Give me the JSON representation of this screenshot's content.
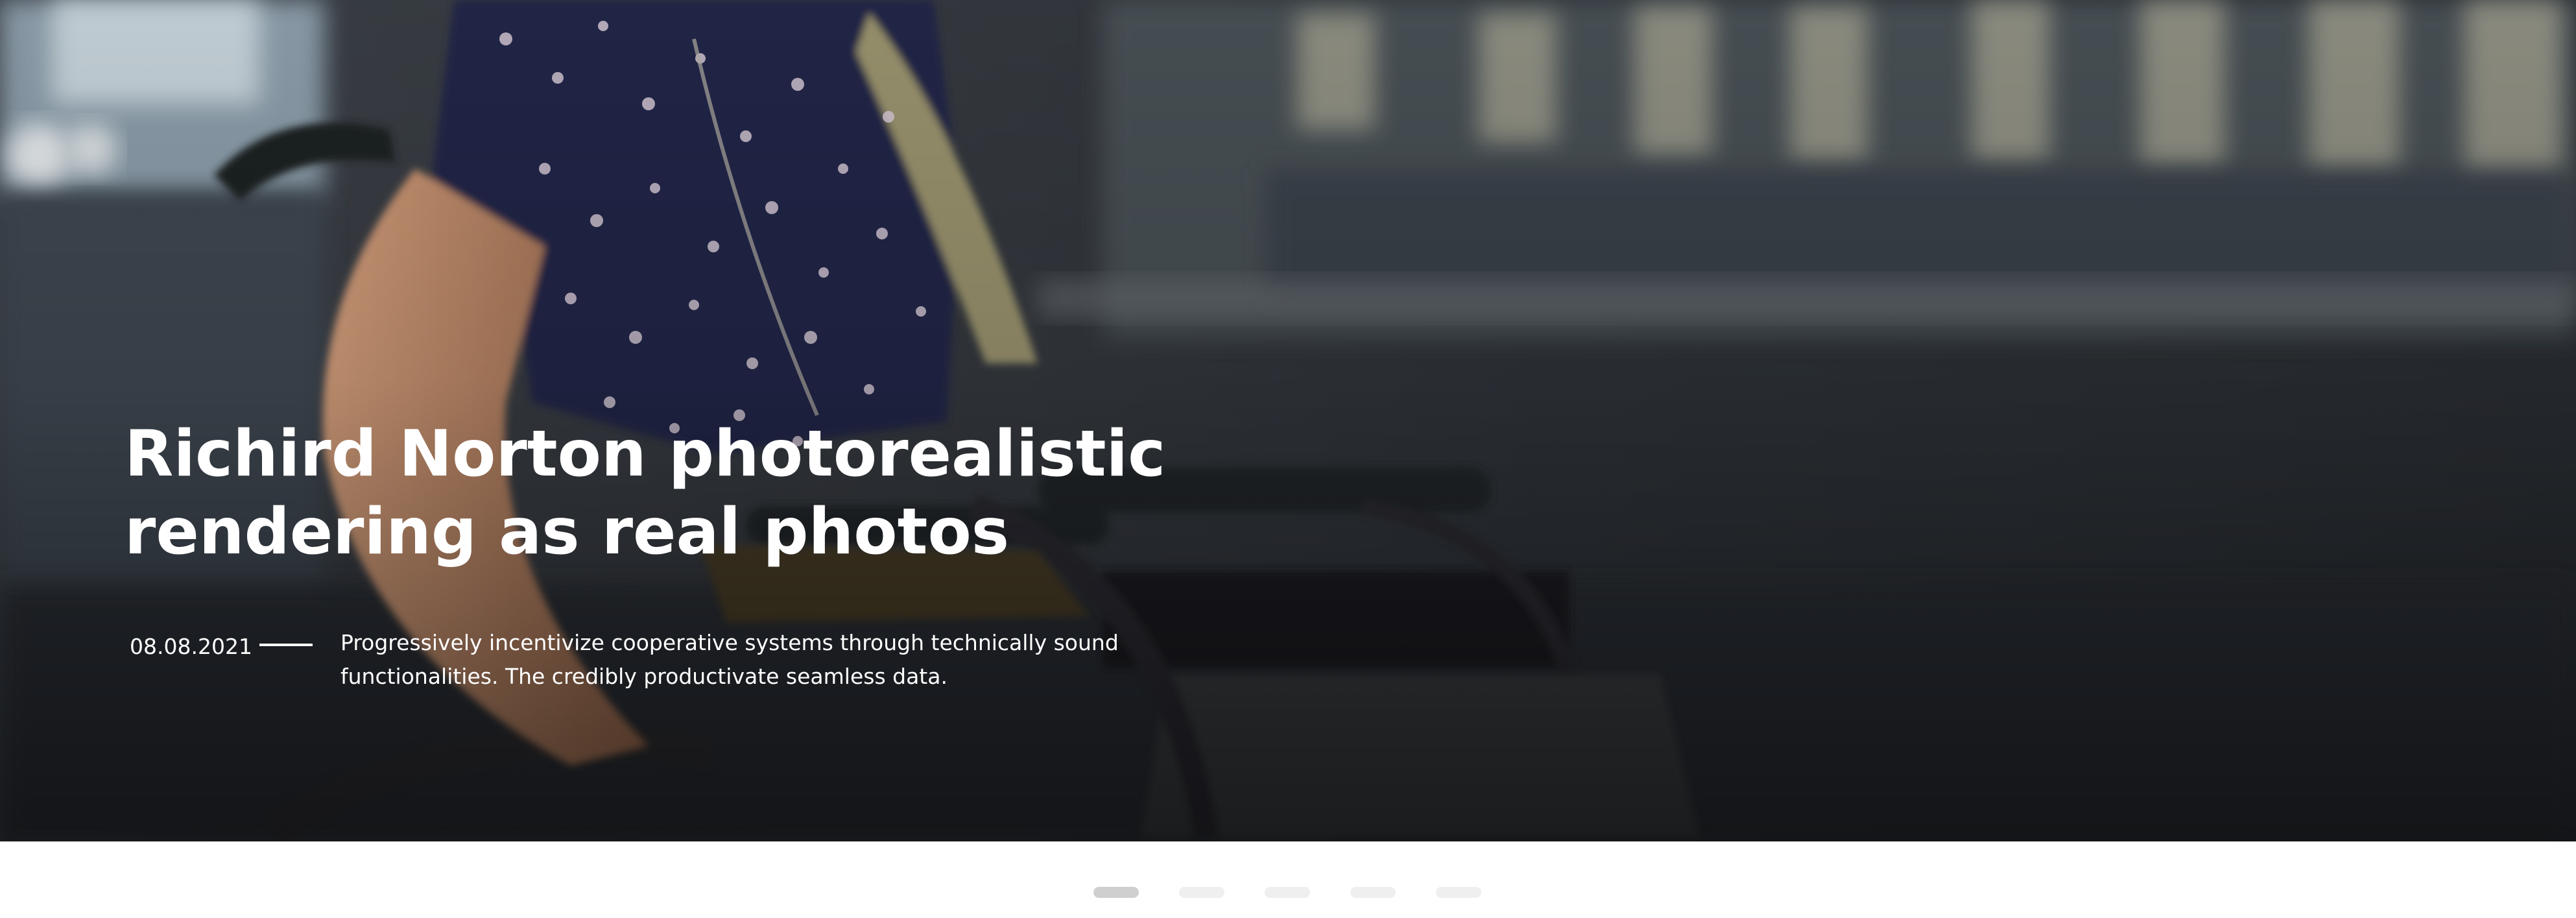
{
  "hero": {
    "title_line1": "Richird Norton photorealistic",
    "title_line2": "rendering as real photos",
    "date": "08.08.2021",
    "description_line1": "Progressively incentivize cooperative systems through technically sound",
    "description_line2": "functionalities. The credibly productivate seamless data."
  },
  "pager": {
    "count": 5,
    "active_index": 0
  },
  "colors": {
    "hero_text": "#ffffff",
    "dot_active": "#cfcfcf",
    "dot_inactive": "#efefef",
    "page_background": "#ffffff"
  }
}
